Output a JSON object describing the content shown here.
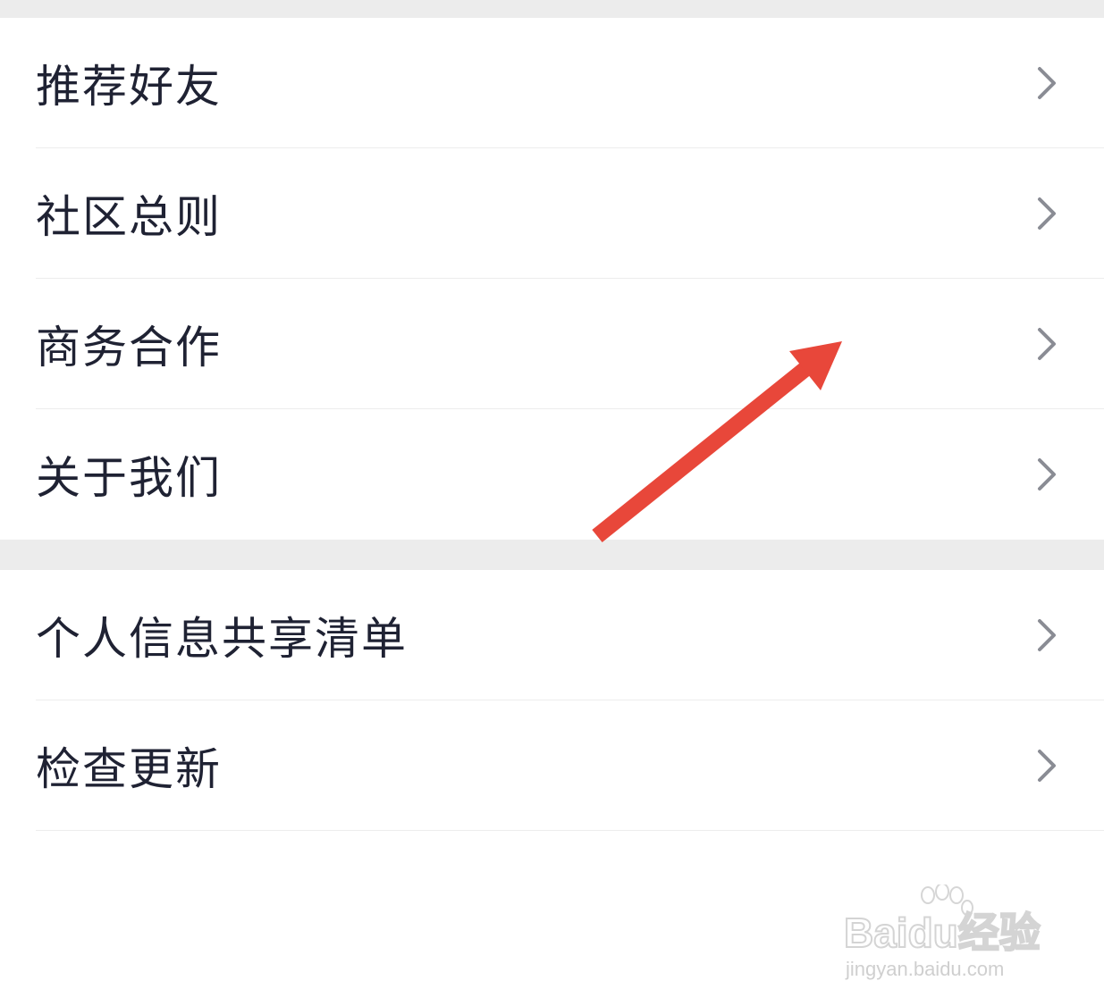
{
  "menu_group_1": [
    {
      "label": "推荐好友"
    },
    {
      "label": "社区总则"
    },
    {
      "label": "商务合作"
    },
    {
      "label": "关于我们"
    }
  ],
  "menu_group_2": [
    {
      "label": "个人信息共享清单"
    },
    {
      "label": "检查更新"
    }
  ],
  "annotation": {
    "arrow_color": "#e8473a"
  },
  "watermark": {
    "brand": "Baidu经验",
    "url": "jingyan.baidu.com"
  },
  "icons": {
    "chevron": "chevron-right-icon"
  }
}
